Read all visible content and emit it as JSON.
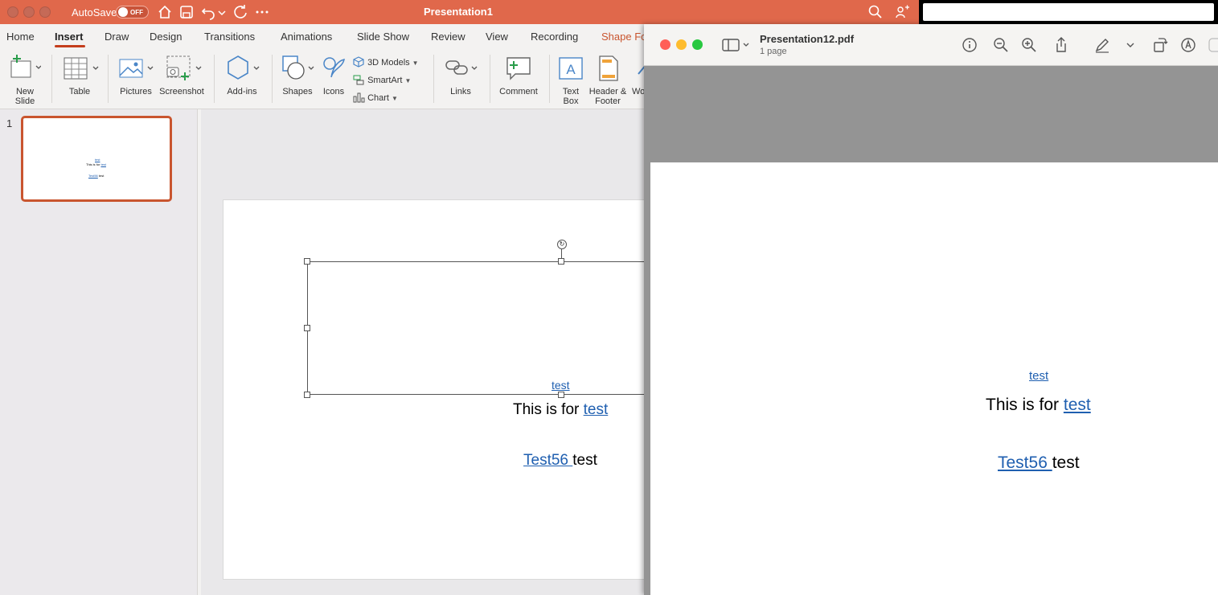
{
  "ppt": {
    "autosave_label": "AutoSave",
    "autosave_state": "OFF",
    "title": "Presentation1",
    "tabs": [
      "Home",
      "Insert",
      "Draw",
      "Design",
      "Transitions",
      "Animations",
      "Slide Show",
      "Review",
      "View",
      "Recording",
      "Shape Fo"
    ],
    "active_tab": "Insert",
    "ribbon": {
      "new_slide_1": "New",
      "new_slide_2": "Slide",
      "table": "Table",
      "pictures": "Pictures",
      "screenshot": "Screenshot",
      "add_ins": "Add-ins",
      "shapes": "Shapes",
      "icons": "Icons",
      "models_3d": "3D Models",
      "smartart": "SmartArt",
      "chart": "Chart",
      "links": "Links",
      "comment": "Comment",
      "text_box_1": "Text",
      "text_box_2": "Box",
      "header_footer_1": "Header &",
      "header_footer_2": "Footer",
      "wordart_cut": "Wo"
    },
    "thumbnail": {
      "slide_number": "1",
      "mini_link": "test",
      "mini_line": "This is for",
      "mini_line_link": "test",
      "mini_bottom_link": "Test56",
      "mini_bottom_text": "test"
    },
    "slide": {
      "top_link": "test",
      "line_text": "This is for ",
      "line_link": "test",
      "bottom_link": "Test56 ",
      "bottom_text": "test"
    }
  },
  "pdf": {
    "file_name": "Presentation12.pdf",
    "page_count": "1 page",
    "page": {
      "top_link": "test",
      "line_text": "This is for ",
      "line_link": "test",
      "bottom_link": "Test56 ",
      "bottom_text": "test"
    }
  },
  "colors": {
    "ppt_accent": "#e0684b",
    "link": "#1f5fb0",
    "mac_close": "#ff5f57",
    "mac_min": "#febc2e",
    "mac_max": "#28c840"
  }
}
